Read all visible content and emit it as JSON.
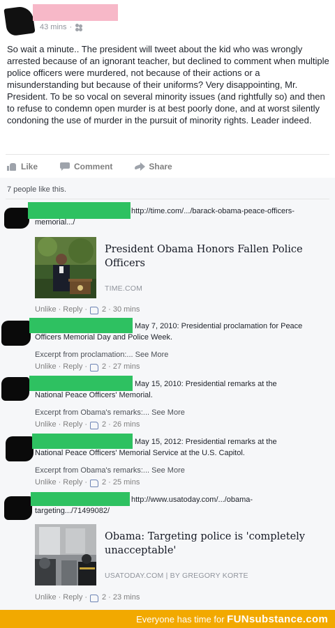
{
  "post": {
    "time": "43 mins",
    "privacy_icon": "friends-icon",
    "text": "So wait a minute.. The president will tweet about the kid who was wrongly arrested because of an ignorant teacher, but declined to comment when multiple police officers were murdered, not because of their actions or a misunderstanding but because of their uniforms? Very disappointing, Mr. President. To be so vocal on several minority issues (and rightfully so) and then to refuse to condemn open murder is at best poorly done, and at worst silently condoning the use of murder in the pursuit of minority rights. Leader indeed."
  },
  "actions": {
    "like": "Like",
    "comment": "Comment",
    "share": "Share"
  },
  "likes_summary": "7 people like this.",
  "comments": [
    {
      "text_line1": "http://time.com/.../barack-obama-peace-officers-",
      "text_line2": "memorial.../",
      "link": {
        "title": "President Obama Honors Fallen Police Officers",
        "source": "TIME.COM"
      },
      "unlike": "Unlike",
      "reply": "Reply",
      "likes": "2",
      "time": "30 mins"
    },
    {
      "text_line1": "May 7, 2010: Presidential proclamation for Peace",
      "text_line2": "Officers Memorial Day and Police Week.",
      "excerpt": "Excerpt from proclamation:...",
      "see_more": "See More",
      "unlike": "Unlike",
      "reply": "Reply",
      "likes": "2",
      "time": "27 mins"
    },
    {
      "text_line1": "May 15, 2010: Presidential remarks at the",
      "text_line2": "National Peace Officers' Memorial.",
      "excerpt": "Excerpt from Obama's remarks:...",
      "see_more": "See More",
      "unlike": "Unlike",
      "reply": "Reply",
      "likes": "2",
      "time": "26 mins"
    },
    {
      "text_line1": "May 15, 2012: Presidential remarks at the",
      "text_line2": "National Peace Officers' Memorial Service at the U.S. Capitol.",
      "excerpt": "Excerpt from Obama's remarks:...",
      "see_more": "See More",
      "unlike": "Unlike",
      "reply": "Reply",
      "likes": "2",
      "time": "25 mins"
    },
    {
      "text_line1": "http://www.usatoday.com/.../obama-",
      "text_line2": "targeting.../71499082/",
      "link": {
        "title": "Obama: Targeting police is 'completely unacceptable'",
        "source": "USATODAY.COM | BY GREGORY KORTE"
      },
      "unlike": "Unlike",
      "reply": "Reply",
      "likes": "2",
      "time": "23 mins"
    }
  ],
  "footer": {
    "tagline": "Everyone has time for",
    "brand": "FUNsubstance.com"
  },
  "colors": {
    "redaction_green": "#2ec161",
    "redaction_pink": "#f7b8c8",
    "footer_bg": "#f2a900"
  }
}
